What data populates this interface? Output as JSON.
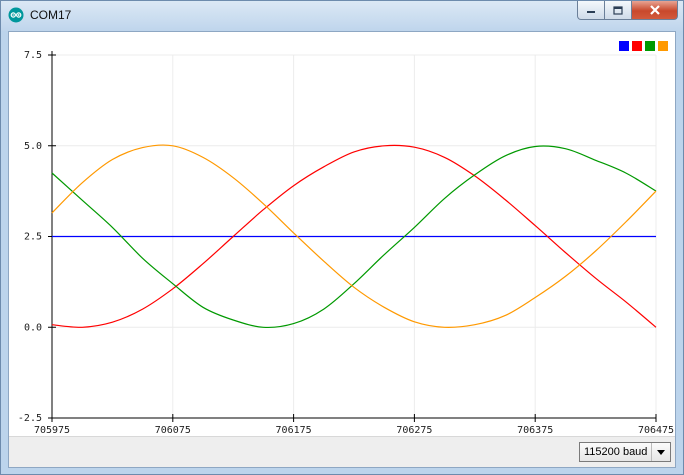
{
  "window": {
    "title": "COM17",
    "icon": "arduino-icon"
  },
  "controls": [
    "minimize-icon",
    "maximize-icon",
    "close-icon"
  ],
  "statusbar": {
    "baud_label": "115200 baud",
    "dropdown_icon": "chevron-down-icon"
  },
  "chart_data": {
    "type": "line",
    "title": "",
    "xlabel": "",
    "ylabel": "",
    "xlim": [
      705975,
      706475
    ],
    "ylim": [
      -2.5,
      7.5
    ],
    "x_ticks": [
      "705975",
      "706075",
      "706175",
      "706275",
      "706375",
      "706475"
    ],
    "y_ticks": [
      "7.5",
      "5.0",
      "2.5",
      "0.0",
      "-2.5"
    ],
    "grid": true,
    "legend_position": "top-right",
    "x": [
      705975,
      706000,
      706025,
      706050,
      706075,
      706100,
      706125,
      706150,
      706175,
      706200,
      706225,
      706250,
      706275,
      706300,
      706325,
      706350,
      706375,
      706400,
      706425,
      706450,
      706475
    ],
    "series": [
      {
        "color": "#0000ff",
        "values": [
          2.5,
          2.5,
          2.5,
          2.5,
          2.5,
          2.5,
          2.5,
          2.5,
          2.5,
          2.5,
          2.5,
          2.5,
          2.5,
          2.5,
          2.5,
          2.5,
          2.5,
          2.5,
          2.5,
          2.5,
          2.5
        ]
      },
      {
        "color": "#ff0000",
        "values": [
          0.07,
          0.0,
          0.14,
          0.5,
          1.06,
          1.75,
          2.5,
          3.24,
          3.9,
          4.42,
          4.83,
          5.0,
          4.96,
          4.68,
          4.17,
          3.52,
          2.8,
          2.06,
          1.35,
          0.7,
          0.0
        ]
      },
      {
        "color": "#009900",
        "values": [
          4.25,
          3.5,
          2.75,
          1.9,
          1.2,
          0.55,
          0.2,
          0.0,
          0.1,
          0.5,
          1.2,
          2.0,
          2.75,
          3.55,
          4.2,
          4.72,
          4.98,
          4.92,
          4.6,
          4.25,
          3.75
        ]
      },
      {
        "color": "#ff9900",
        "values": [
          3.15,
          3.98,
          4.62,
          4.95,
          5.0,
          4.68,
          4.12,
          3.4,
          2.6,
          1.82,
          1.1,
          0.55,
          0.15,
          0.0,
          0.07,
          0.32,
          0.82,
          1.4,
          2.1,
          2.9,
          3.75
        ]
      }
    ]
  }
}
